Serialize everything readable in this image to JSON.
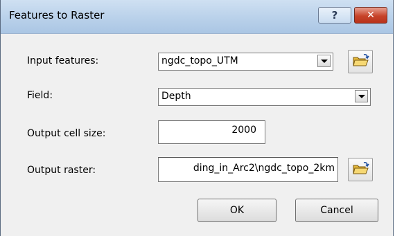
{
  "window": {
    "title": "Features to Raster",
    "help_glyph": "?",
    "close_glyph": "✕"
  },
  "fields": {
    "input_features": {
      "label": "Input features:",
      "value": "ngdc_topo_UTM"
    },
    "field": {
      "label": "Field:",
      "value": "Depth"
    },
    "cell_size": {
      "label": "Output cell size:",
      "value": "2000"
    },
    "output_raster": {
      "label": "Output raster:",
      "value": "ding_in_Arc2\\ngdc_topo_2km"
    }
  },
  "buttons": {
    "ok": "OK",
    "cancel": "Cancel"
  },
  "icons": {
    "browse": "folder-open-icon",
    "dropdown": "chevron-down-icon"
  }
}
